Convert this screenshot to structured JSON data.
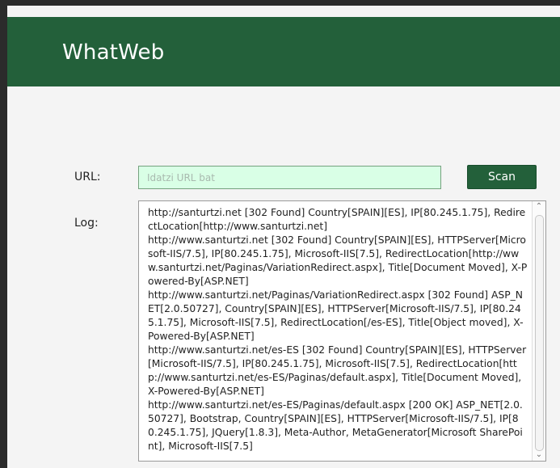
{
  "app": {
    "title": "WhatWeb"
  },
  "form": {
    "url_label": "URL:",
    "url_placeholder": "Idatzi URL bat",
    "url_value": "",
    "scan_label": "Scan",
    "log_label": "Log:"
  },
  "log": {
    "text": "http://santurtzi.net [302 Found] Country[SPAIN][ES], IP[80.245.1.75], RedirectLocation[http://www.santurtzi.net]\nhttp://www.santurtzi.net [302 Found] Country[SPAIN][ES], HTTPServer[Microsoft-IIS/7.5], IP[80.245.1.75], Microsoft-IIS[7.5], RedirectLocation[http://www.santurtzi.net/Paginas/VariationRedirect.aspx], Title[Document Moved], X-Powered-By[ASP.NET]\nhttp://www.santurtzi.net/Paginas/VariationRedirect.aspx [302 Found] ASP_NET[2.0.50727], Country[SPAIN][ES], HTTPServer[Microsoft-IIS/7.5], IP[80.245.1.75], Microsoft-IIS[7.5], RedirectLocation[/es-ES], Title[Object moved], X-Powered-By[ASP.NET]\nhttp://www.santurtzi.net/es-ES [302 Found] Country[SPAIN][ES], HTTPServer[Microsoft-IIS/7.5], IP[80.245.1.75], Microsoft-IIS[7.5], RedirectLocation[http://www.santurtzi.net/es-ES/Paginas/default.aspx], Title[Document Moved], X-Powered-By[ASP.NET]\nhttp://www.santurtzi.net/es-ES/Paginas/default.aspx [200 OK] ASP_NET[2.0.50727], Bootstrap, Country[SPAIN][ES], HTTPServer[Microsoft-IIS/7.5], IP[80.245.1.75], JQuery[1.8.3], Meta-Author, MetaGenerator[Microsoft SharePoint], Microsoft-IIS[7.5]"
  },
  "icons": {
    "scroll_up": "chevron-up-icon",
    "scroll_down": "chevron-down-icon"
  },
  "colors": {
    "brand_green": "#23603a",
    "input_background": "#d9ffe6",
    "window_background": "#f4f4f4"
  }
}
